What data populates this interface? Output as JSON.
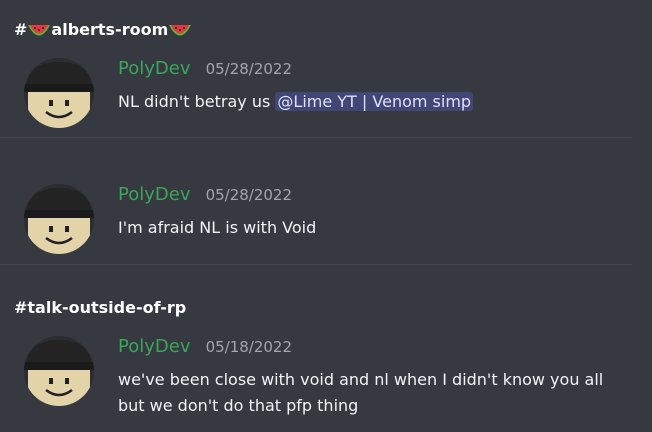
{
  "colors": {
    "background": "#36393f",
    "author": "#3ba55c",
    "mention_bg": "#414675"
  },
  "sections": [
    {
      "channel": {
        "prefix": "#",
        "name": "alberts-room",
        "icon": "watermelon-icon"
      },
      "messages": [
        {
          "author": "PolyDev",
          "timestamp": "05/28/2022",
          "text": "NL didn't betray us ",
          "mention": "@Lime YT | Venom simp"
        }
      ]
    },
    {
      "messages": [
        {
          "author": "PolyDev",
          "timestamp": "05/28/2022",
          "text": "I'm afraid NL is with Void"
        }
      ]
    },
    {
      "channel": {
        "prefix": "#",
        "name": "talk-outside-of-rp"
      },
      "messages": [
        {
          "author": "PolyDev",
          "timestamp": "05/18/2022",
          "lines": [
            "we've been close with void and nl when I didn't know you all",
            "but we don't do that pfp thing"
          ]
        }
      ]
    }
  ]
}
